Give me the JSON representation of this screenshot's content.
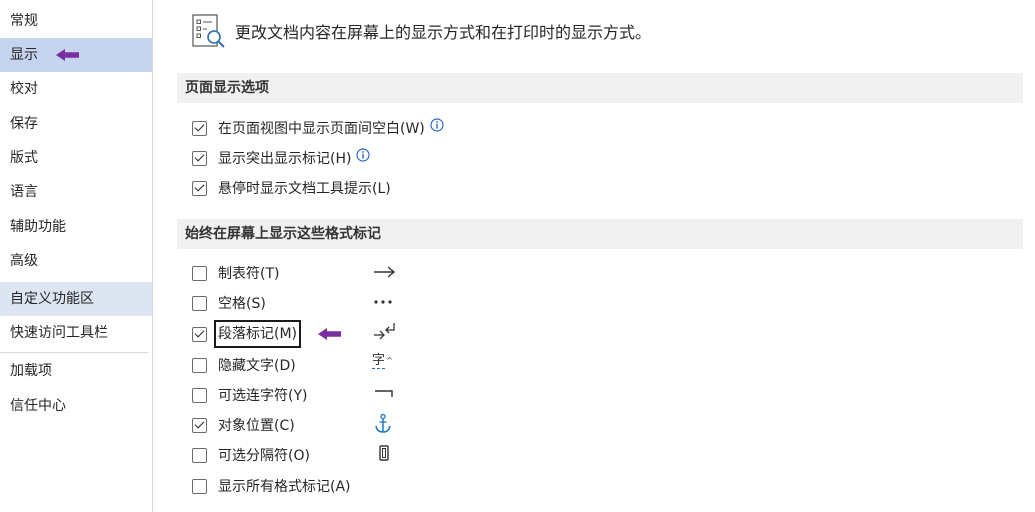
{
  "sidebar": {
    "items": [
      {
        "label": "常规"
      },
      {
        "label": "显示"
      },
      {
        "label": "校对"
      },
      {
        "label": "保存"
      },
      {
        "label": "版式"
      },
      {
        "label": "语言"
      },
      {
        "label": "辅助功能"
      },
      {
        "label": "高级"
      },
      {
        "label": "自定义功能区"
      },
      {
        "label": "快速访问工具栏"
      },
      {
        "label": "加载项"
      },
      {
        "label": "信任中心"
      }
    ]
  },
  "header": {
    "text": "更改文档内容在屏幕上的显示方式和在打印时的显示方式。"
  },
  "page_display": {
    "title": "页面显示选项",
    "options": [
      {
        "label": "在页面视图中显示页面间空白(W)",
        "checked": true
      },
      {
        "label": "显示突出显示标记(H)",
        "checked": true
      },
      {
        "label": "悬停时显示文档工具提示(L)",
        "checked": true
      }
    ]
  },
  "format_marks": {
    "title": "始终在屏幕上显示这些格式标记",
    "options": [
      {
        "label": "制表符(T)",
        "checked": false,
        "symbol": "tab-arrow-icon"
      },
      {
        "label": "空格(S)",
        "checked": false,
        "symbol": "space-dots-icon"
      },
      {
        "label": "段落标记(M)",
        "checked": true,
        "symbol": "paragraph-mark-icon"
      },
      {
        "label": "隐藏文字(D)",
        "checked": false,
        "symbol": "hidden-text-icon",
        "symbol_text": "字"
      },
      {
        "label": "可选连字符(Y)",
        "checked": false,
        "symbol": "optional-hyphen-icon"
      },
      {
        "label": "对象位置(C)",
        "checked": true,
        "symbol": "anchor-icon"
      },
      {
        "label": "可选分隔符(O)",
        "checked": false,
        "symbol": "optional-break-icon"
      },
      {
        "label": "显示所有格式标记(A)",
        "checked": false
      }
    ]
  },
  "colors": {
    "selected_nav": "#c5d4ee",
    "hover_nav": "#dde5f3",
    "annotation_arrow": "#7a2fa0",
    "info_icon": "#2a6bb8",
    "anchor": "#2a7ec4"
  }
}
